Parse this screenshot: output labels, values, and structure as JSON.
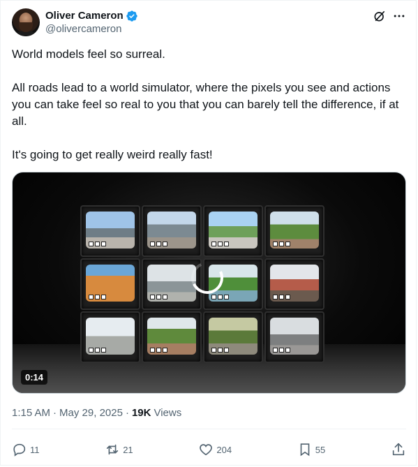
{
  "author": {
    "display_name": "Oliver Cameron",
    "handle": "@olivercameron",
    "verified": true,
    "verified_color": "#1d9bf0"
  },
  "header_icons": [
    "grok-icon",
    "more-icon"
  ],
  "tweet": {
    "paragraphs": [
      "World models feel so surreal.",
      "All roads lead to a world simulator, where the pixels you see and actions you can take feel so real to you that you can barely tell the difference, if at all.",
      "It's going to get really weird really fast!"
    ]
  },
  "media": {
    "duration": "0:14"
  },
  "meta": {
    "time": "1:15 AM",
    "date": "May 29, 2025",
    "views_count": "19K",
    "views_label": "Views",
    "separator": "·"
  },
  "actions": {
    "replies": "11",
    "reposts": "21",
    "likes": "204",
    "bookmarks": "55"
  }
}
